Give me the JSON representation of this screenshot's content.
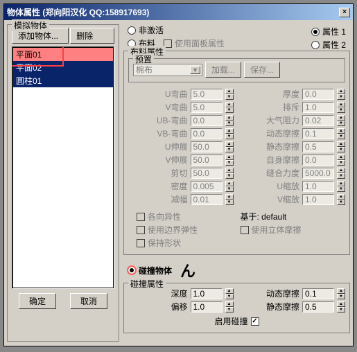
{
  "title": "物体属性 (郑向阳汉化  QQ:158917693)",
  "left": {
    "group": "模拟物体",
    "add": "添加物体...",
    "remove": "删除",
    "items": [
      "平面01",
      "平面02",
      "圆柱01"
    ],
    "ok": "确定",
    "cancel": "取消"
  },
  "top_radios": {
    "inactive": "非激活",
    "prop1": "属性 1",
    "prop2": "属性 2",
    "cloth": "布料",
    "use_panel": "使用面板属性"
  },
  "cloth": {
    "group": "布料属性",
    "preset": "预置",
    "preset_value": "棉布",
    "load": "加载...",
    "save": "保存...",
    "params_left": [
      {
        "label": "U弯曲",
        "value": "5.0"
      },
      {
        "label": "V弯曲",
        "value": "5.0"
      },
      {
        "label": "UB-弯曲",
        "value": "0.0"
      },
      {
        "label": "VB-弯曲",
        "value": "0.0"
      },
      {
        "label": "U伸展",
        "value": "50.0"
      },
      {
        "label": "V伸展",
        "value": "50.0"
      },
      {
        "label": "剪切",
        "value": "50.0"
      },
      {
        "label": "密度",
        "value": "0.005"
      },
      {
        "label": "减幅",
        "value": "0.01"
      }
    ],
    "params_right": [
      {
        "label": "厚度",
        "value": "0.0"
      },
      {
        "label": "排斥",
        "value": "1.0"
      },
      {
        "label": "大气阻力",
        "value": "0.02"
      },
      {
        "label": "动态摩擦",
        "value": "0.1"
      },
      {
        "label": "静态摩擦",
        "value": "0.5"
      },
      {
        "label": "自身摩擦",
        "value": "0.0"
      },
      {
        "label": "缝合力度",
        "value": "5000.0"
      },
      {
        "label": "U缩放",
        "value": "1.0"
      },
      {
        "label": "V缩放",
        "value": "1.0"
      }
    ],
    "aniso": "各向异性",
    "edge_spring": "使用边界弹性",
    "keep_shape": "保持形状",
    "based_on": "基于: default",
    "solid_friction": "使用立体摩擦"
  },
  "collision": {
    "radio": "碰撞物体",
    "group": "碰撞属性",
    "depth": {
      "label": "深度",
      "value": "1.0"
    },
    "offset": {
      "label": "偏移",
      "value": "1.0"
    },
    "dyn": {
      "label": "动态摩擦",
      "value": "0.1"
    },
    "stat": {
      "label": "静态摩擦",
      "value": "0.5"
    },
    "enable": "启用碰撞"
  }
}
